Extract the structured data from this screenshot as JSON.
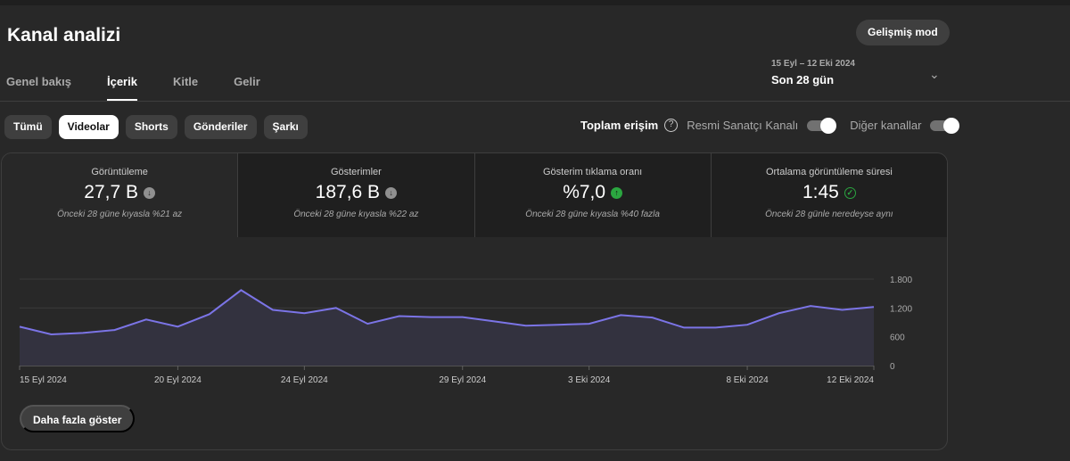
{
  "header": {
    "title": "Kanal analizi",
    "advanced_mode": "Gelişmiş mod"
  },
  "tabs": [
    {
      "label": "Genel bakış"
    },
    {
      "label": "İçerik",
      "active": true
    },
    {
      "label": "Kitle"
    },
    {
      "label": "Gelir"
    }
  ],
  "date_range": {
    "range": "15 Eyl – 12 Eki 2024",
    "period": "Son 28 gün"
  },
  "filters": [
    {
      "label": "Tümü"
    },
    {
      "label": "Videolar",
      "active": true
    },
    {
      "label": "Shorts"
    },
    {
      "label": "Gönderiler"
    },
    {
      "label": "Şarkı"
    }
  ],
  "reach": {
    "label": "Toplam erişim",
    "official_artist": "Resmi Sanatçı Kanalı",
    "official_artist_on": true,
    "other_channels": "Diğer kanallar",
    "other_channels_on": true
  },
  "metrics": [
    {
      "label": "Görüntüleme",
      "value": "27,7 B",
      "trend": "down",
      "note": "Önceki 28 güne kıyasla %21 az"
    },
    {
      "label": "Gösterimler",
      "value": "187,6 B",
      "trend": "down",
      "note": "Önceki 28 güne kıyasla %22 az"
    },
    {
      "label": "Gösterim tıklama oranı",
      "value": "%7,0",
      "trend": "up",
      "note": "Önceki 28 güne kıyasla %40 fazla"
    },
    {
      "label": "Ortalama görüntüleme süresi",
      "value": "1:45",
      "trend": "same",
      "note": "Önceki 28 günle neredeyse aynı"
    }
  ],
  "colors": {
    "line": "#7b74e6",
    "fill": "#33323f",
    "up": "#2ba640"
  },
  "chart_data": {
    "type": "area",
    "x": [
      "15 Eyl 2024",
      "16 Eyl 2024",
      "17 Eyl 2024",
      "18 Eyl 2024",
      "19 Eyl 2024",
      "20 Eyl 2024",
      "21 Eyl 2024",
      "22 Eyl 2024",
      "23 Eyl 2024",
      "24 Eyl 2024",
      "25 Eyl 2024",
      "26 Eyl 2024",
      "27 Eyl 2024",
      "28 Eyl 2024",
      "29 Eyl 2024",
      "30 Eyl 2024",
      "1 Eki 2024",
      "2 Eki 2024",
      "3 Eki 2024",
      "4 Eki 2024",
      "5 Eki 2024",
      "6 Eki 2024",
      "7 Eki 2024",
      "8 Eki 2024",
      "9 Eki 2024",
      "10 Eki 2024",
      "11 Eki 2024",
      "12 Eki 2024"
    ],
    "values": [
      810,
      650,
      680,
      740,
      960,
      810,
      1070,
      1570,
      1160,
      1090,
      1200,
      870,
      1030,
      1010,
      1010,
      920,
      830,
      850,
      870,
      1050,
      1000,
      790,
      790,
      850,
      1090,
      1240,
      1160,
      1220
    ],
    "xticks": [
      "15 Eyl 2024",
      "20 Eyl 2024",
      "24 Eyl 2024",
      "29 Eyl 2024",
      "3 Eki 2024",
      "8 Eki 2024",
      "12 Eki 2024"
    ],
    "yticks": [
      "0",
      "600",
      "1.200",
      "1.800"
    ],
    "ylim": [
      0,
      1800
    ],
    "grid": true
  },
  "show_more": "Daha fazla göster"
}
